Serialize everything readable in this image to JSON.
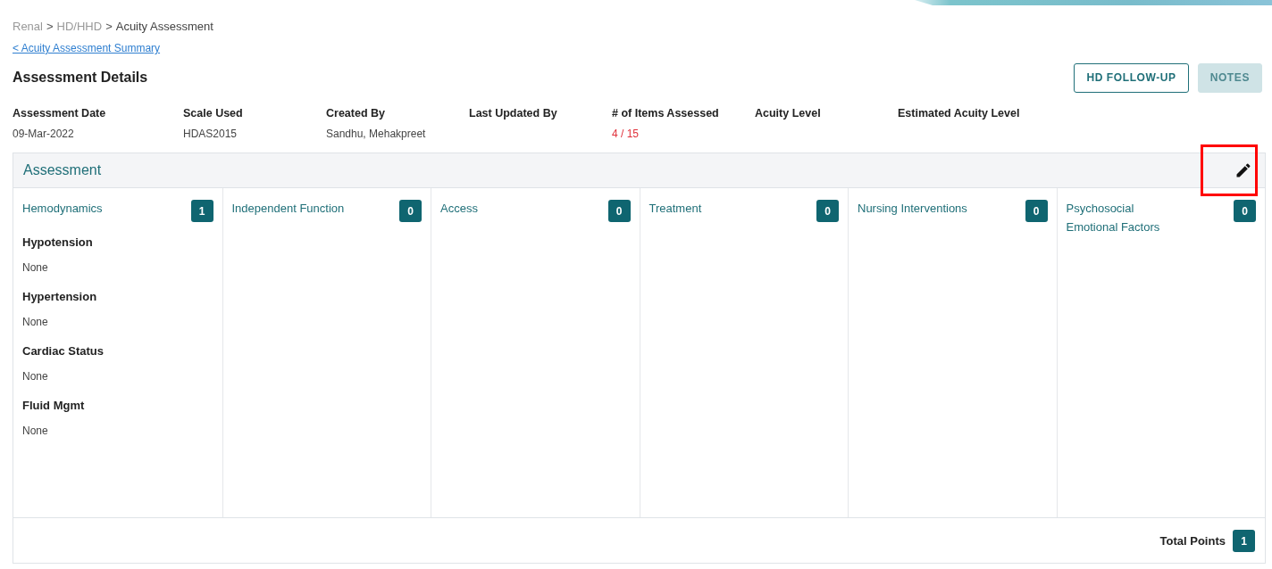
{
  "breadcrumb": [
    {
      "label": "Renal",
      "current": false
    },
    {
      "label": "HD/HHD",
      "current": false
    },
    {
      "label": "Acuity Assessment",
      "current": true
    }
  ],
  "breadcrumb_separator": ">",
  "back_link": "< Acuity Assessment Summary",
  "title": "Assessment Details",
  "buttons": [
    {
      "label": "HD FOLLOW-UP",
      "disabled": false
    },
    {
      "label": "NOTES",
      "disabled": true
    }
  ],
  "fields": [
    {
      "label": "Assessment Date",
      "value": "09-Mar-2022",
      "alert": false
    },
    {
      "label": "Scale Used",
      "value": "HDAS2015",
      "alert": false
    },
    {
      "label": "Created By",
      "value": "Sandhu, Mehakpreet",
      "alert": false
    },
    {
      "label": "Last Updated By"
    },
    {
      "label": "# of Items Assessed",
      "value": "4 / 15",
      "alert": true
    },
    {
      "label": "Acuity Level"
    },
    {
      "label": "Estimated Acuity Level"
    }
  ],
  "assessment": {
    "title": "Assessment",
    "edit_highlighted": true,
    "categories": [
      {
        "name": "Hemodynamics",
        "count": "1",
        "items": [
          {
            "label": "Hypotension",
            "value": "None"
          },
          {
            "label": "Hypertension",
            "value": "None"
          },
          {
            "label": "Cardiac Status",
            "value": "None"
          },
          {
            "label": "Fluid Mgmt",
            "value": "None"
          }
        ]
      },
      {
        "name": "Independent Function",
        "count": "0"
      },
      {
        "name": "Access",
        "count": "0"
      },
      {
        "name": "Treatment",
        "count": "0"
      },
      {
        "name": "Nursing Interventions",
        "count": "0"
      },
      {
        "name": "Psychosocial Emotional Factors",
        "count": "0"
      }
    ],
    "total_label": "Total Points",
    "total": "1"
  }
}
